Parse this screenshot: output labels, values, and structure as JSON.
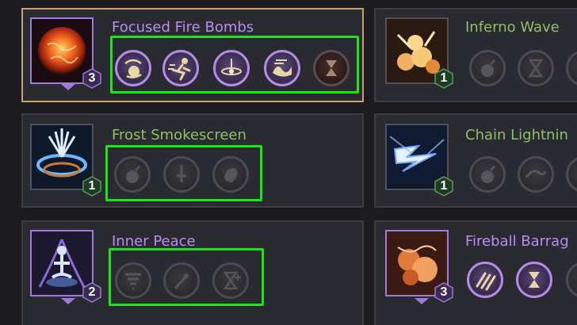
{
  "skills": [
    {
      "title": "Focused Fire Bombs",
      "level": "3"
    },
    {
      "title": "Inferno Wave",
      "level": "1"
    },
    {
      "title": "Frost Smokescreen",
      "level": "1"
    },
    {
      "title": "Chain Lightnin",
      "level": "1"
    },
    {
      "title": "Inner Peace",
      "level": "2"
    },
    {
      "title": "Fireball Barrag",
      "level": "3"
    }
  ],
  "colors": {
    "background": "#1b1b20",
    "card": "#2a2a31",
    "selected_border": "#c9a26b",
    "highlight_box": "#19e619",
    "title_purple": "#b98df0",
    "title_green": "#8fbf6a",
    "active_node_ring": "#b48be8"
  },
  "icons": {
    "focused_fire_bombs": [
      "bomb-spin-icon",
      "running-figure-icon",
      "orbit-ring-icon",
      "flame-wave-icon",
      "hourglass-icon"
    ],
    "inferno_wave": [
      "bomb-icon",
      "hourglass-icon"
    ],
    "frost_smokescreen": [
      "bomb-icon",
      "dagger-icon",
      "fist-icon"
    ],
    "chain_lightning": [
      "bomb-icon",
      "wave-icon"
    ],
    "inner_peace": [
      "tornado-icon",
      "blade-icon",
      "hourglass-plus-icon"
    ],
    "fireball_barrage": [
      "triple-dart-icon",
      "hourglass-icon"
    ]
  }
}
